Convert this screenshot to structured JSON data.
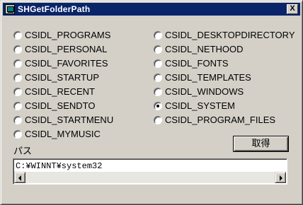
{
  "window": {
    "title": "SHGetFolderPath",
    "close_glyph": "X"
  },
  "radios_left": [
    {
      "label": "CSIDL_PROGRAMS",
      "checked": false
    },
    {
      "label": "CSIDL_PERSONAL",
      "checked": false
    },
    {
      "label": "CSIDL_FAVORITES",
      "checked": false
    },
    {
      "label": "CSIDL_STARTUP",
      "checked": false
    },
    {
      "label": "CSIDL_RECENT",
      "checked": false
    },
    {
      "label": "CSIDL_SENDTO",
      "checked": false
    },
    {
      "label": "CSIDL_STARTMENU",
      "checked": false
    },
    {
      "label": "CSIDL_MYMUSIC",
      "checked": false
    }
  ],
  "radios_right": [
    {
      "label": "CSIDL_DESKTOPDIRECTORY",
      "checked": false
    },
    {
      "label": "CSIDL_NETHOOD",
      "checked": false
    },
    {
      "label": "CSIDL_FONTS",
      "checked": false
    },
    {
      "label": "CSIDL_TEMPLATES",
      "checked": false
    },
    {
      "label": "CSIDL_WINDOWS",
      "checked": false
    },
    {
      "label": "CSIDL_SYSTEM",
      "checked": true
    },
    {
      "label": "CSIDL_PROGRAM_FILES",
      "checked": false
    }
  ],
  "path_label": "パス",
  "get_button_label": "取得",
  "path_value": "C:¥WINNT¥system32",
  "icons": {
    "app": "app-window-icon",
    "close": "close-icon",
    "scroll_left": "scroll-left-arrow-icon",
    "scroll_right": "scroll-right-arrow-icon"
  },
  "colors": {
    "titlebar": "#0a246a",
    "face": "#d4d0c8"
  }
}
